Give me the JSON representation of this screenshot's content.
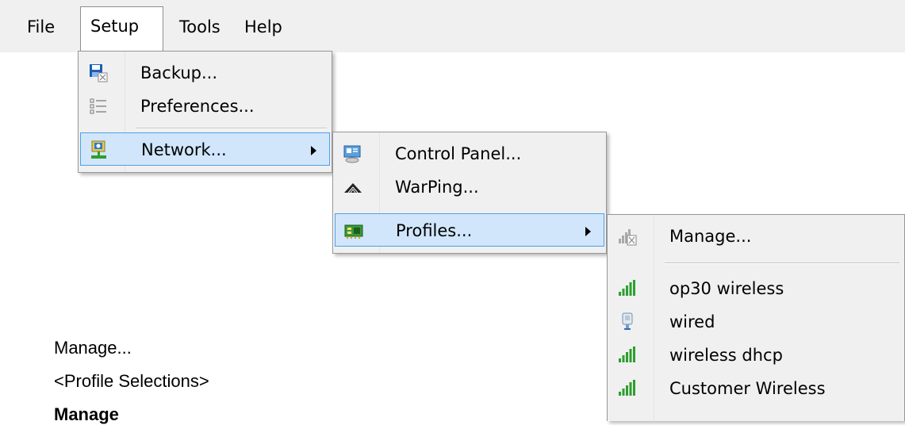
{
  "menubar": {
    "items": [
      "File",
      "Setup",
      "Tools",
      "Help"
    ]
  },
  "setup_menu": {
    "items": [
      {
        "label": "Backup...",
        "icon": "backup-icon"
      },
      {
        "label": "Preferences...",
        "icon": "preferences-icon"
      },
      {
        "label": "Network...",
        "icon": "network-icon",
        "submenu": true
      }
    ]
  },
  "network_menu": {
    "items": [
      {
        "label": "Control Panel...",
        "icon": "control-panel-icon"
      },
      {
        "label": "WarPing...",
        "icon": "warping-icon"
      },
      {
        "label": "Profiles...",
        "icon": "profiles-icon",
        "submenu": true
      }
    ]
  },
  "profiles_menu": {
    "items": [
      {
        "label": "Manage...",
        "icon": "manage-signal-icon"
      },
      {
        "label": "op30 wireless",
        "icon": "signal-bars-icon"
      },
      {
        "label": "wired",
        "icon": "wired-plug-icon"
      },
      {
        "label": "wireless dhcp",
        "icon": "signal-bars-icon"
      },
      {
        "label": "Customer Wireless",
        "icon": "signal-bars-icon"
      }
    ]
  },
  "captions": {
    "line1": "Manage...",
    "line2": "<Profile Selections>",
    "line3": "Manage"
  },
  "colors": {
    "highlight_bg": "#d1e6fb",
    "highlight_border": "#4da0e8",
    "menu_bg": "#f0f0f0",
    "signal_green": "#2e9e2e"
  }
}
